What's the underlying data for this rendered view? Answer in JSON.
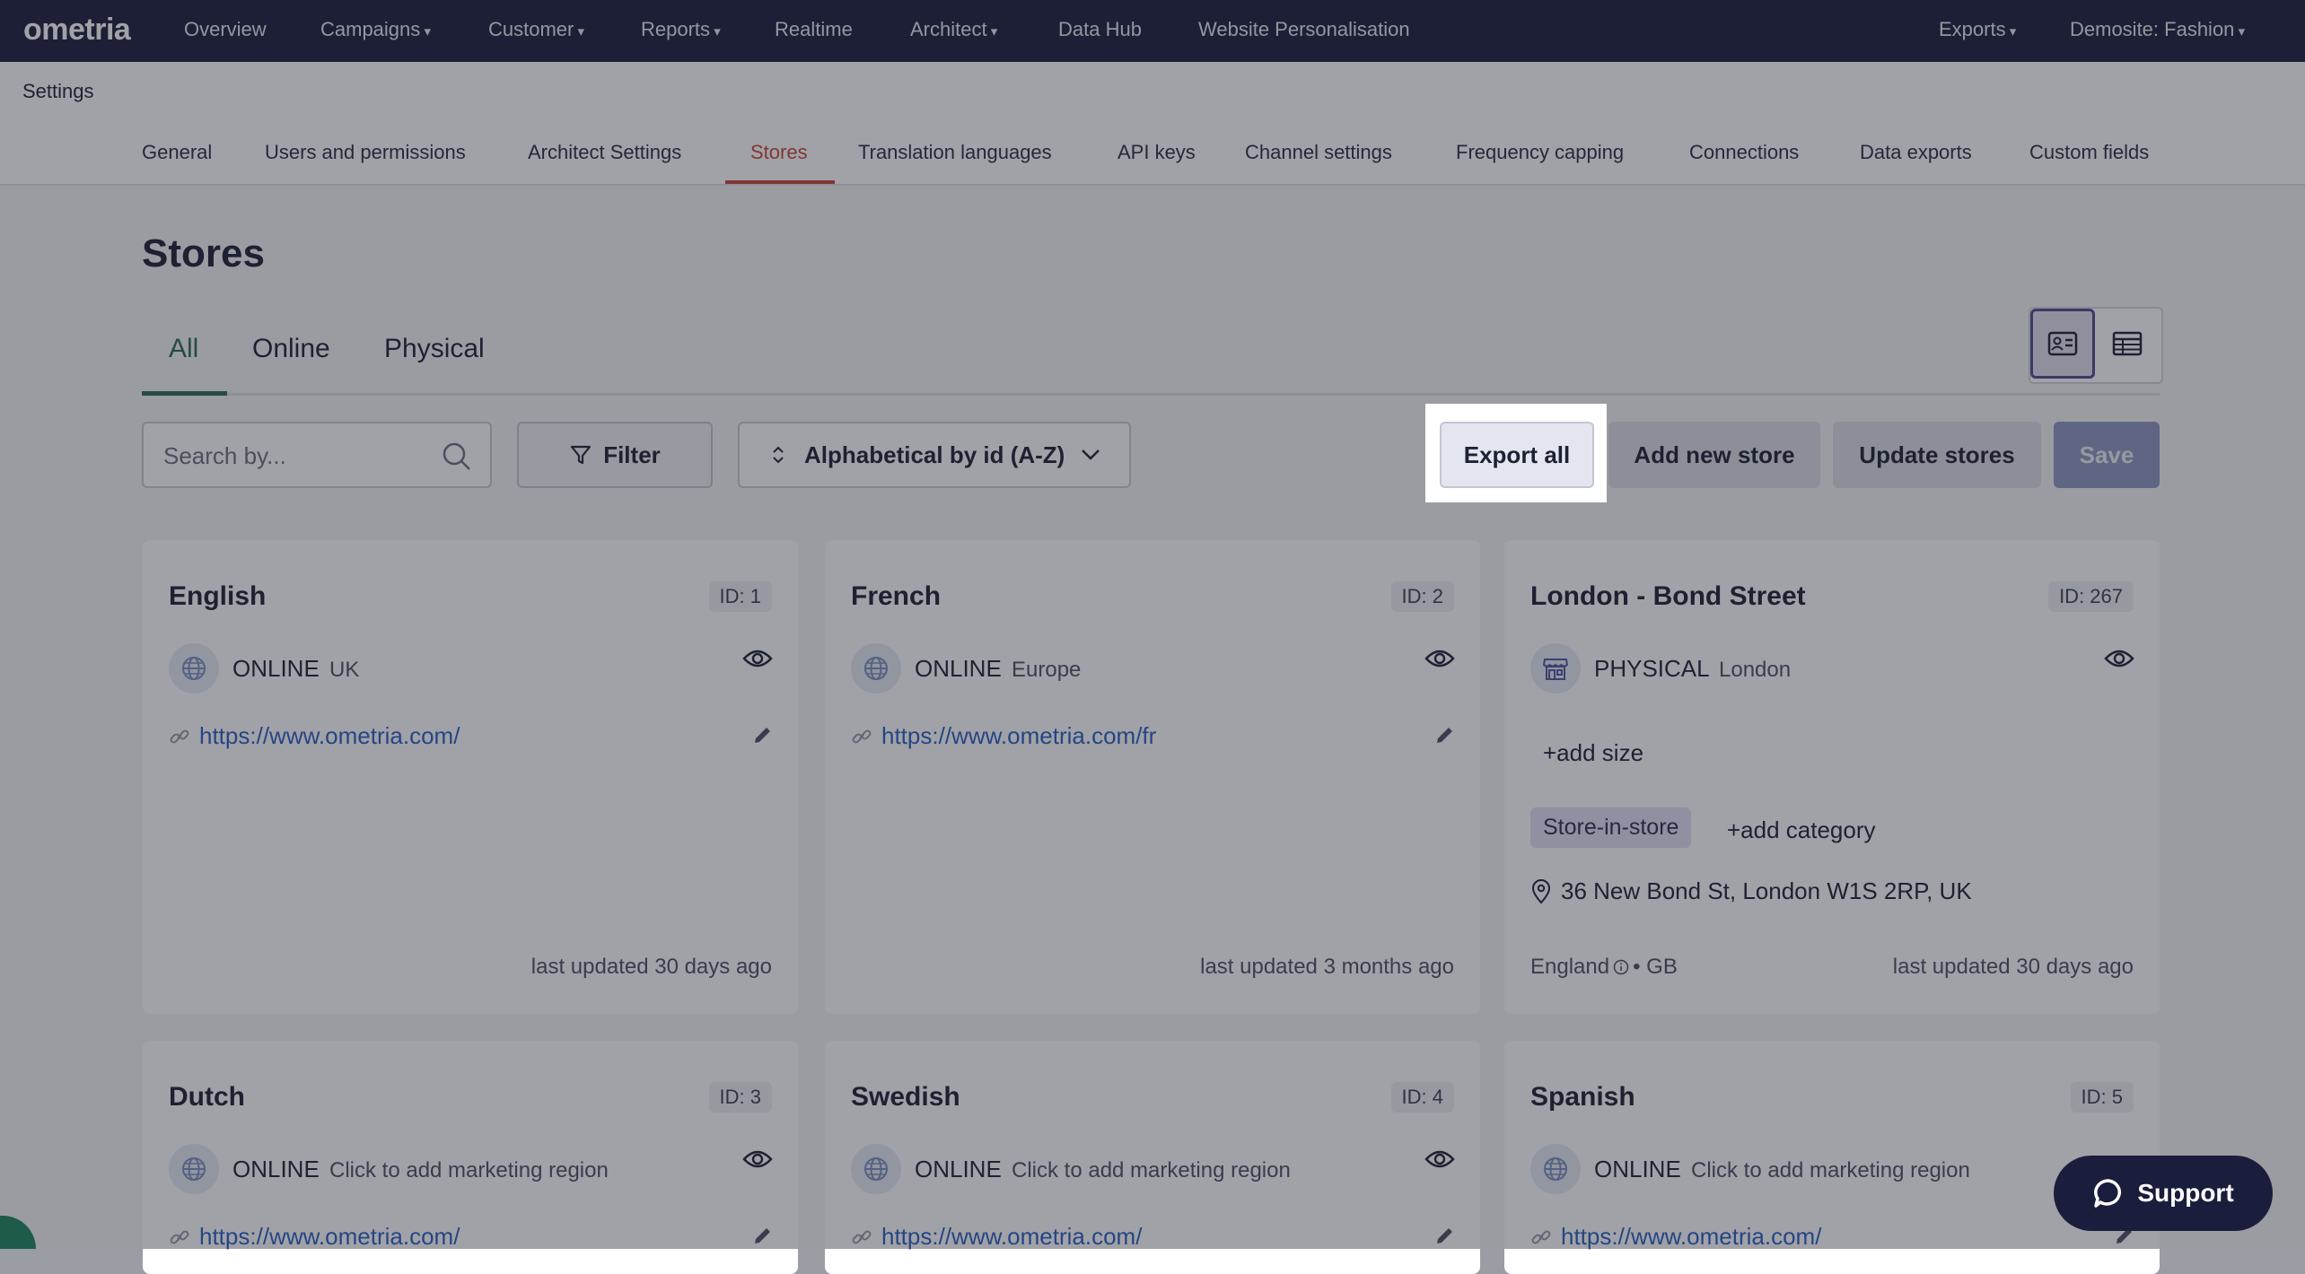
{
  "topnav": {
    "logo": "ometria",
    "items": [
      "Overview",
      "Campaigns",
      "Customer",
      "Reports",
      "Realtime",
      "Architect",
      "Data Hub",
      "Website Personalisation"
    ],
    "exports": "Exports",
    "account": "Demosite: Fashion"
  },
  "breadcrumb": "Settings",
  "settings_tabs": [
    "General",
    "Users and permissions",
    "Architect Settings",
    "Stores",
    "Translation languages",
    "API keys",
    "Channel settings",
    "Frequency capping",
    "Connections",
    "Data exports",
    "Custom fields"
  ],
  "active_settings_tab": "Stores",
  "page_title": "Stores",
  "store_tabs": [
    "All",
    "Online",
    "Physical"
  ],
  "toolbar": {
    "search_placeholder": "Search by...",
    "filter_label": "Filter",
    "sort_label": "Alphabetical by id (A-Z)",
    "export_label": "Export all",
    "add_label": "Add new store",
    "update_label": "Update stores",
    "save_label": "Save"
  },
  "stores": [
    {
      "name": "English",
      "id": "ID: 1",
      "type": "ONLINE",
      "region": "UK",
      "url": "https://www.ometria.com/",
      "updated": "last updated 30 days ago"
    },
    {
      "name": "French",
      "id": "ID: 2",
      "type": "ONLINE",
      "region": "Europe",
      "url": "https://www.ometria.com/fr",
      "updated": "last updated 3 months ago"
    },
    {
      "name": "London - Bond Street",
      "id": "ID: 267",
      "type": "PHYSICAL",
      "region": "London",
      "add_size": "+add size",
      "tag": "Store-in-store",
      "add_category": "+add category",
      "address": "36 New Bond St, London W1S 2RP, UK",
      "country": "England",
      "country_suffix": "• GB",
      "updated": "last updated 30 days ago"
    },
    {
      "name": "Dutch",
      "id": "ID: 3",
      "type": "ONLINE",
      "region": "Click to add marketing region",
      "url": "https://www.ometria.com/"
    },
    {
      "name": "Swedish",
      "id": "ID: 4",
      "type": "ONLINE",
      "region": "Click to add marketing region",
      "url": "https://www.ometria.com/"
    },
    {
      "name": "Spanish",
      "id": "ID: 5",
      "type": "ONLINE",
      "region": "Click to add marketing region",
      "url": "https://www.ometria.com/"
    }
  ],
  "support_label": "Support"
}
